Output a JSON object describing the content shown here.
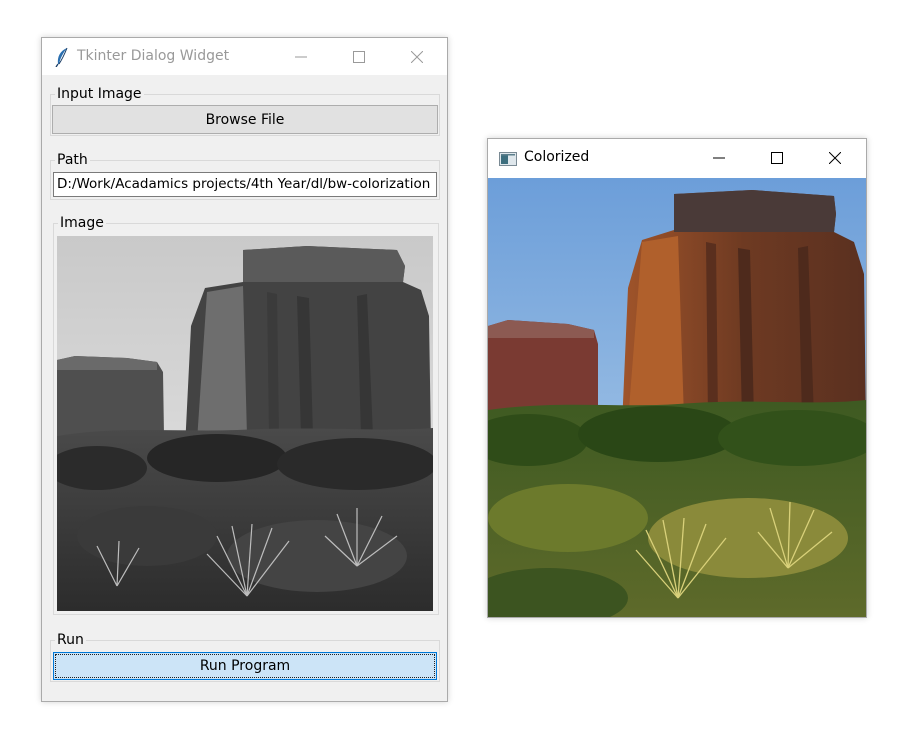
{
  "dialog": {
    "title": "Tkinter Dialog Widget",
    "input_group_label": "Input Image",
    "browse_button": "Browse File",
    "path_group_label": "Path",
    "path_value": "D:/Work/Acadamics projects/4th Year/dl/bw-colorization",
    "image_group_label": "Image",
    "run_group_label": "Run",
    "run_button": "Run Program"
  },
  "colorized": {
    "title": "Colorized"
  },
  "colors": {
    "focus_border": "#0078d7",
    "focus_fill": "#cce4f7",
    "window_bg": "#f0f0f0",
    "titlebar_bg": "#ffffff"
  },
  "icons": [
    "feather-icon",
    "minimize-icon",
    "maximize-icon",
    "close-icon",
    "window-image-icon"
  ]
}
